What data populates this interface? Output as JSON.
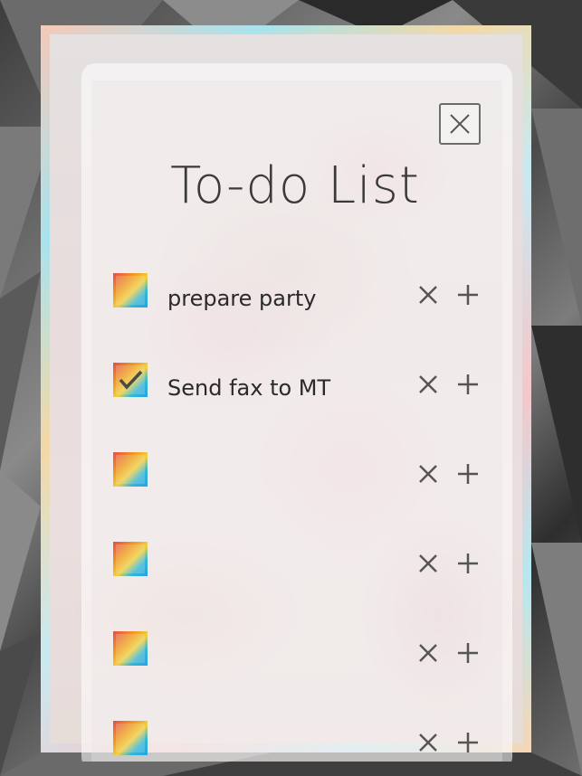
{
  "title": "To-do List",
  "tasks": [
    {
      "text": "prepare party",
      "checked": false
    },
    {
      "text": "Send fax to MT",
      "checked": true
    },
    {
      "text": "",
      "checked": false
    },
    {
      "text": "",
      "checked": false
    },
    {
      "text": "",
      "checked": false
    },
    {
      "text": "",
      "checked": false
    }
  ],
  "icons": {
    "close": "close-icon",
    "delete": "times-icon",
    "add": "plus-icon",
    "check": "checkmark-icon"
  },
  "colors": {
    "text": "#2a2a2a",
    "icon": "#555555",
    "checkbox_gradient": [
      "#e84a4a",
      "#f0a020",
      "#f2d040",
      "#30b8d8"
    ]
  }
}
